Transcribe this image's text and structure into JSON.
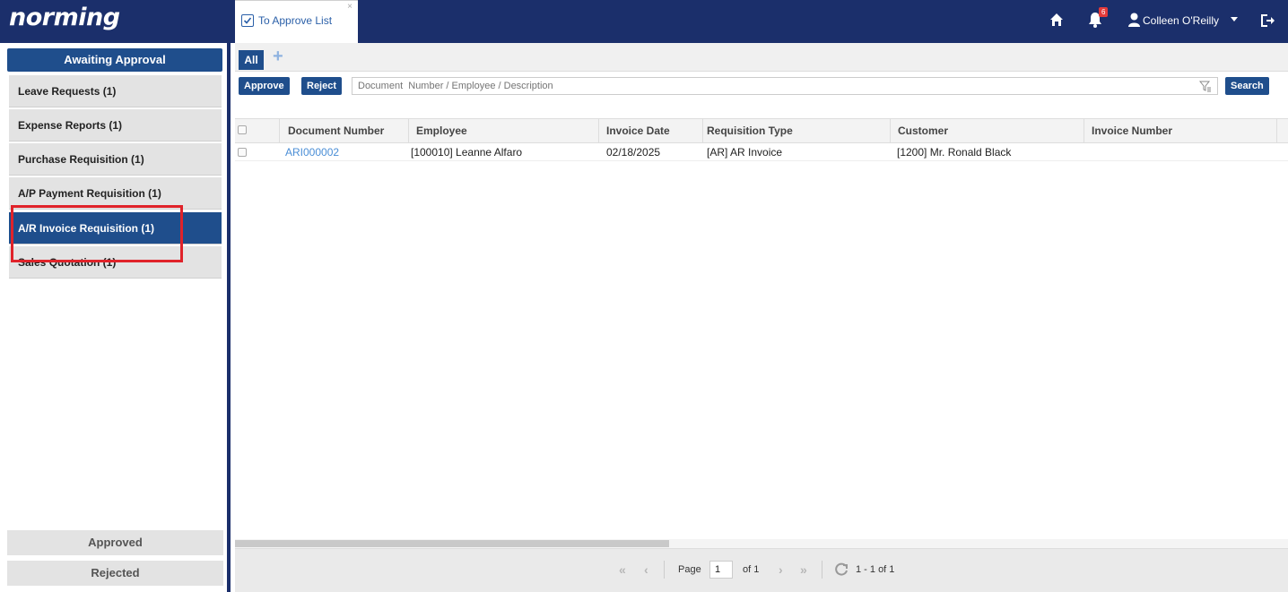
{
  "app": {
    "logo": "norming"
  },
  "doc_tab": {
    "title": "To Approve List",
    "close": "×"
  },
  "header": {
    "notification_count": "6",
    "user_name": "Colleen O'Reilly"
  },
  "sidebar": {
    "awaiting": "Awaiting Approval",
    "items": [
      {
        "label": "Leave Requests (1)"
      },
      {
        "label": "Expense Reports (1)"
      },
      {
        "label": "Purchase Requisition (1)"
      },
      {
        "label": "A/P Payment Requisition (1)"
      },
      {
        "label": "A/R Invoice Requisition (1)"
      },
      {
        "label": "Sales Quotation (1)"
      }
    ],
    "approved": "Approved",
    "rejected": "Rejected"
  },
  "tabs": {
    "all": "All",
    "add": "+"
  },
  "toolbar": {
    "approve": "Approve",
    "reject": "Reject",
    "search_placeholder": "Document  Number / Employee / Description",
    "search": "Search"
  },
  "grid": {
    "columns": [
      "Document Number",
      "Employee",
      "Invoice Date",
      "Requisition Type",
      "Customer",
      "Invoice Number"
    ],
    "rows": [
      {
        "document_number": "ARI000002",
        "employee": "[100010] Leanne Alfaro",
        "invoice_date": "02/18/2025",
        "requisition_type": "[AR] AR Invoice",
        "customer": "[1200] Mr. Ronald Black",
        "invoice_number": ""
      }
    ]
  },
  "pager": {
    "page_label": "Page",
    "page": "1",
    "of": "of 1",
    "range": "1 - 1 of 1"
  },
  "colors": {
    "nav_dark": "#1b2f6b",
    "accent": "#1f4e8c",
    "highlight": "#e0232a",
    "link": "#4a8ed6"
  }
}
